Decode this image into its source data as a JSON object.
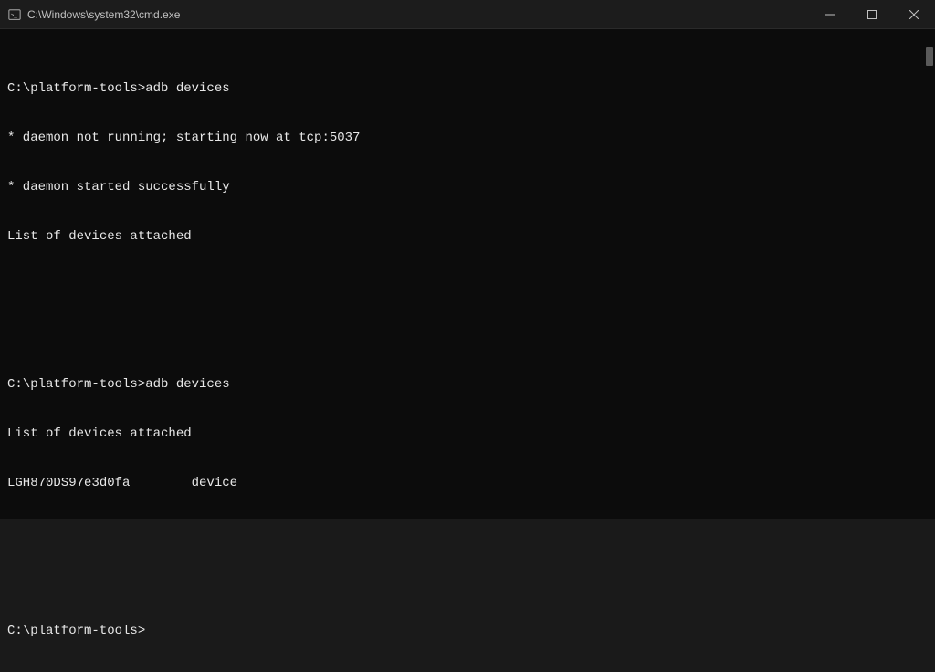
{
  "window": {
    "title": "C:\\Windows\\system32\\cmd.exe"
  },
  "terminal": {
    "lines": [
      "C:\\platform-tools>adb devices",
      "* daemon not running; starting now at tcp:5037",
      "* daemon started successfully",
      "List of devices attached",
      "",
      "",
      "C:\\platform-tools>adb devices",
      "List of devices attached",
      "LGH870DS97e3d0fa        device",
      "",
      "",
      "C:\\platform-tools>"
    ]
  }
}
